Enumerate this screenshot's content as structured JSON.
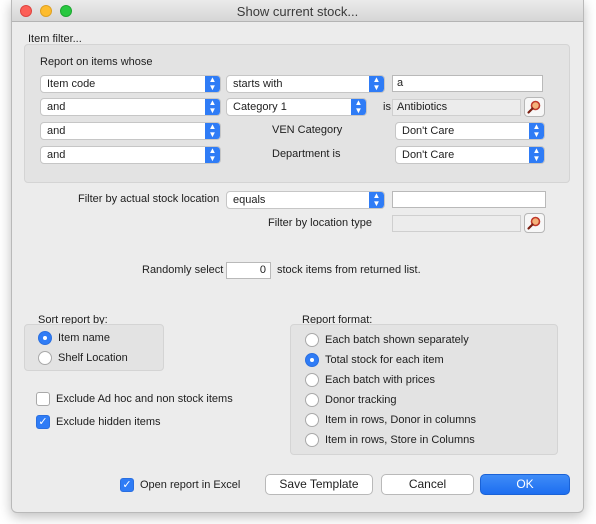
{
  "window": {
    "title": "Show current stock..."
  },
  "item_filter": {
    "heading": "Item filter...",
    "report_on_label": "Report on items whose",
    "row1": {
      "field": "Item code",
      "operator": "starts with",
      "value": "a"
    },
    "row2": {
      "conjunction": "and",
      "field": "Category 1",
      "is_label": "is",
      "value": "Antibiotics"
    },
    "row3": {
      "conjunction": "and",
      "field_label": "VEN Category",
      "value": "Don't Care"
    },
    "row4": {
      "conjunction": "and",
      "field_label": "Department is",
      "value": "Don't Care"
    }
  },
  "location": {
    "label": "Filter by actual stock location",
    "operator": "equals",
    "value": "",
    "type_label": "Filter by location type",
    "type_value": ""
  },
  "random": {
    "label_before": "Randomly select",
    "value": "0",
    "label_after": "stock items from returned list."
  },
  "sort": {
    "heading": "Sort report by:",
    "options": [
      "Item name",
      "Shelf Location"
    ],
    "selected": 0
  },
  "checkboxes": {
    "exclude_adhoc": {
      "label": "Exclude Ad hoc and non stock items",
      "checked": false
    },
    "exclude_hidden": {
      "label": "Exclude hidden items",
      "checked": true
    }
  },
  "report_format": {
    "heading": "Report format:",
    "options": [
      "Each batch shown separately",
      "Total stock for each item",
      "Each batch with prices",
      "Donor tracking",
      "Item in rows, Donor in columns",
      "Item in rows, Store in Columns"
    ],
    "selected": 1
  },
  "footer": {
    "open_excel": {
      "label": "Open report in Excel",
      "checked": true
    },
    "save_template": "Save Template",
    "cancel": "Cancel",
    "ok": "OK"
  },
  "colors": {
    "accent": "#2f7cf6",
    "window_bg": "#ececec",
    "group_bg": "#e3e3e3"
  },
  "icons": {
    "lookup": "magnifier-icon",
    "dropdown": "chevron-updown-icon"
  }
}
